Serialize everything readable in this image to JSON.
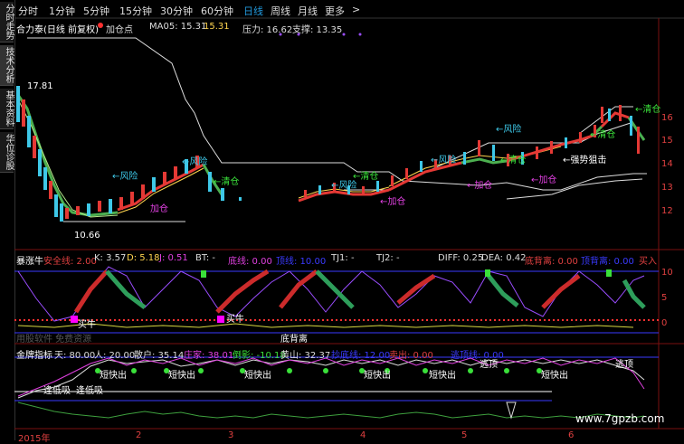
{
  "sidebar": {
    "tabs": [
      "分时走势",
      "技术分析",
      "基本资料",
      "华位诊股"
    ]
  },
  "toolbar": {
    "periods": [
      "分时",
      "1分钟",
      "5分钟",
      "15分钟",
      "30分钟",
      "60分钟",
      "日线",
      "周线",
      "月线",
      "更多"
    ],
    "selected": "日线",
    "more_arrow": ">"
  },
  "main_header": {
    "stock": "合力泰(日线 前复权)",
    "signal": "加仓点",
    "ma_label": "MA05: 15.31",
    "ma_value": "15.31",
    "pressure": "压力: 16.62",
    "support": "支撑: 13.35",
    "high_label": "17.81",
    "low_label": "10.66"
  },
  "main_annotations": {
    "risk": "←风险",
    "clear": "←清仓",
    "add": "加仓",
    "add_right": "←加仓",
    "strong": "←强势狙击"
  },
  "right_axis": [
    "16",
    "15",
    "14",
    "13",
    "12"
  ],
  "sub1": {
    "title": "暴涨牛",
    "safe": "安全线: 2.00",
    "k": "K: 3.57",
    "d": "D: 5.18",
    "j": "J: 0.51",
    "bt": "BT: -",
    "bottom": "底线: 0.00",
    "top": "顶线: 10.00",
    "tj1": "TJ1: -",
    "tj2": "TJ2: -",
    "diff": "DIFF: 0.25",
    "dea": "DEA: 0.42",
    "bottom_div": "底背离: 0.00",
    "top_div": "顶背离: 0.00",
    "buy": "买入",
    "axis": [
      "10",
      "5",
      "0"
    ],
    "buy_label": "买牛",
    "buy_label2": "买牛",
    "bottom_div_label": "底背离",
    "watermark": "用股软件 免费资源"
  },
  "sub2": {
    "title": "金牌指标",
    "tian": "天: 80.00",
    "ren": "人: 20.00",
    "sanhu": "散户: 35.14",
    "zhuangjia": "庄家: 38.01",
    "daoying": "倒影: -10.18",
    "huangshan": "黄山: 32.37",
    "chaodie": "抄底线: 12.00",
    "maichu": "卖出: 0.00",
    "taopao": "逃顶线: 0.00",
    "short_out": "短快出",
    "top_escape": "逃顶",
    "low_buy": "逢低吸",
    "low_buy2": "逢低吸"
  },
  "time_axis": [
    "2015年",
    "2",
    "3",
    "4",
    "5",
    "6"
  ],
  "footer": {
    "watermark": "www.7gpzb.com"
  }
}
